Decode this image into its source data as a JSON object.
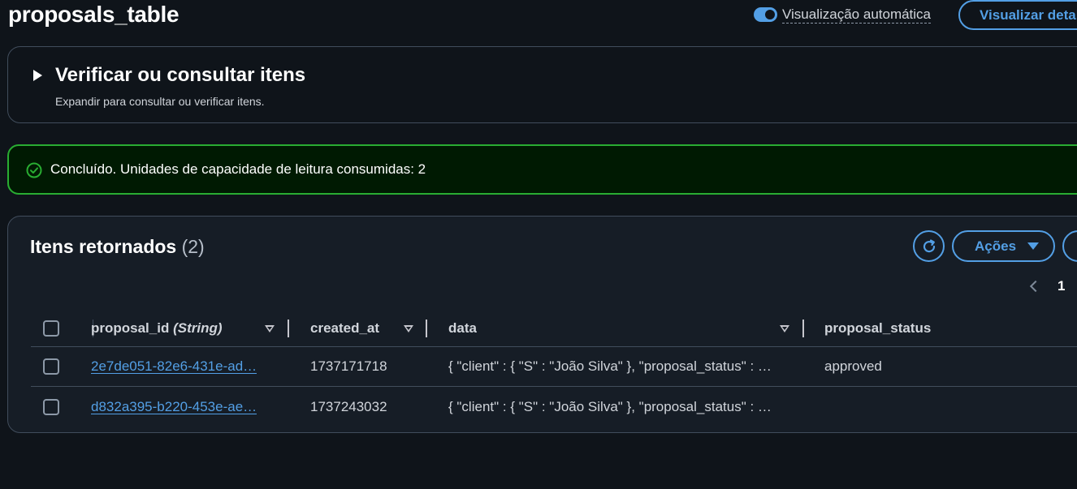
{
  "header": {
    "title": "proposals_table",
    "auto_view_label": "Visualização automática",
    "view_details_button": "Visualizar detalhes"
  },
  "query_panel": {
    "heading": "Verificar ou consultar itens",
    "subtext": "Expandir para consultar ou verificar itens."
  },
  "alert": {
    "message": "Concluído. Unidades de capacidade de leitura consumidas: 2"
  },
  "results": {
    "title": "Itens retornados",
    "count": "(2)",
    "actions_label": "Ações",
    "current_page": "1",
    "columns": [
      {
        "label": "proposal_id",
        "type": "(String)"
      },
      {
        "label": "created_at"
      },
      {
        "label": "data"
      },
      {
        "label": "proposal_status"
      }
    ],
    "rows": [
      {
        "proposal_id": "2e7de051-82e6-431e-ad…",
        "created_at": "1737171718",
        "data": "{ \"client\" : { \"S\" : \"João Silva\" }, \"proposal_status\" : …",
        "proposal_status": "approved"
      },
      {
        "proposal_id": "d832a395-b220-453e-ae…",
        "created_at": "1737243032",
        "data": "{ \"client\" : { \"S\" : \"João Silva\" }, \"proposal_status\" : …",
        "proposal_status": ""
      }
    ]
  },
  "colors": {
    "background": "#0f141a",
    "accent": "#539fe5",
    "success": "#29ad32",
    "border": "#414d5c"
  }
}
